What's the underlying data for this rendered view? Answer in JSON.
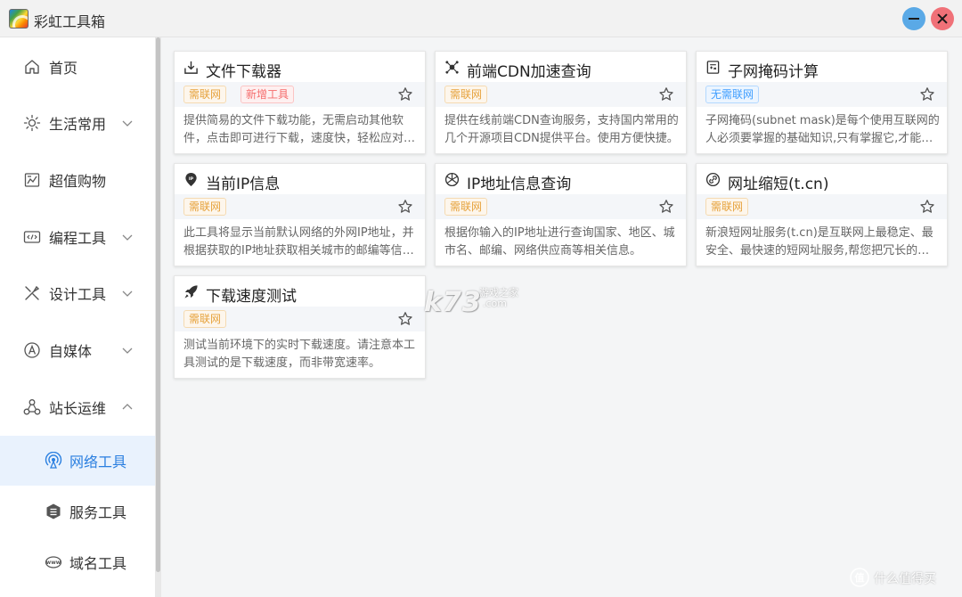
{
  "app": {
    "title": "彩虹工具箱"
  },
  "window_controls": [
    {
      "name": "minimize-icon"
    },
    {
      "name": "close-icon"
    }
  ],
  "sidebar": {
    "items": [
      {
        "label": "首页",
        "icon": "home-icon",
        "expandable": false
      },
      {
        "label": "生活常用",
        "icon": "sun-icon",
        "expandable": true,
        "expanded": false
      },
      {
        "label": "超值购物",
        "icon": "shopping-icon",
        "expandable": false
      },
      {
        "label": "编程工具",
        "icon": "code-icon",
        "expandable": true,
        "expanded": false
      },
      {
        "label": "设计工具",
        "icon": "design-tools-icon",
        "expandable": true,
        "expanded": false
      },
      {
        "label": "自媒体",
        "icon": "media-icon",
        "expandable": true,
        "expanded": false
      },
      {
        "label": "站长运维",
        "icon": "cluster-icon",
        "expandable": true,
        "expanded": true
      }
    ],
    "sub_items": [
      {
        "label": "网络工具",
        "icon": "network-icon",
        "active": true
      },
      {
        "label": "服务工具",
        "icon": "server-icon",
        "active": false
      },
      {
        "label": "域名工具",
        "icon": "www-icon",
        "active": false
      }
    ]
  },
  "tools": [
    {
      "title": "文件下载器",
      "icon": "download-icon",
      "tags": [
        {
          "label": "需联网",
          "color": "orange"
        },
        {
          "label": "新增工具",
          "color": "red"
        }
      ],
      "description": "提供简易的文件下载功能，无需启动其他软件，点击即可进行下载，速度快，轻松应对各种文件下载需求。"
    },
    {
      "title": "前端CDN加速查询",
      "icon": "cdn-icon",
      "tags": [
        {
          "label": "需联网",
          "color": "orange"
        }
      ],
      "description": "提供在线前端CDN查询服务，支持国内常用的几个开源项目CDN提供平台。使用方便快捷。"
    },
    {
      "title": "子网掩码计算",
      "icon": "calculator-icon",
      "tags": [
        {
          "label": "无需联网",
          "color": "blue"
        }
      ],
      "description": "子网掩码(subnet mask)是每个使用互联网的人必须要掌握的基础知识,只有掌握它,才能理解网络划分。"
    },
    {
      "title": "当前IP信息",
      "icon": "ip-location-icon",
      "tags": [
        {
          "label": "需联网",
          "color": "orange"
        }
      ],
      "description": "此工具将显示当前默认网络的外网IP地址，并根据获取的IP地址获取相关城市的邮编等信息。"
    },
    {
      "title": "IP地址信息查询",
      "icon": "globe-search-icon",
      "tags": [
        {
          "label": "需联网",
          "color": "orange"
        }
      ],
      "description": "根据你输入的IP地址进行查询国家、地区、城市名、邮编、网络供应商等相关信息。"
    },
    {
      "title": "网址缩短(t.cn)",
      "icon": "link-icon",
      "tags": [
        {
          "label": "需联网",
          "color": "orange"
        }
      ],
      "description": "新浪短网址服务(t.cn)是互联网上最稳定、最安全、最快速的短网址服务,帮您把冗长的网址变短。"
    },
    {
      "title": "下载速度测试",
      "icon": "rocket-icon",
      "tags": [
        {
          "label": "需联网",
          "color": "orange"
        }
      ],
      "description": "测试当前环境下的实时下载速度。请注意本工具测试的是下载速度，而非带宽速率。"
    }
  ],
  "watermarks": {
    "k73": "k73",
    "k73_site": "游戏之家",
    "k73_domain": ".com",
    "smzdm": "什么值得买"
  }
}
